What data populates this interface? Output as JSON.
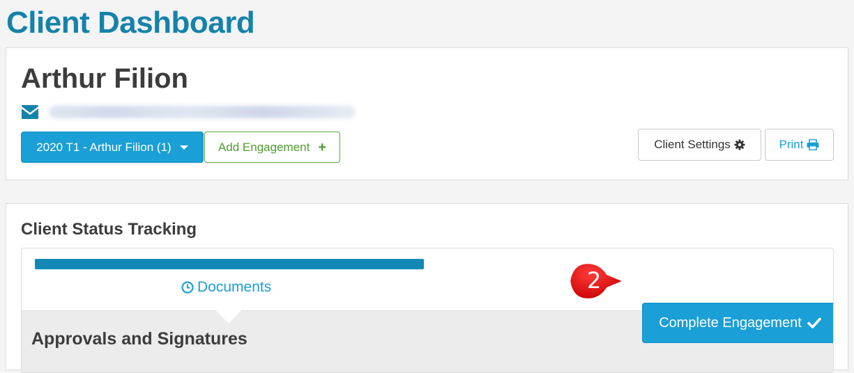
{
  "page": {
    "title": "Client Dashboard"
  },
  "client": {
    "name": "Arthur Filion",
    "email_icon": "envelope-icon"
  },
  "toolbar": {
    "engagement_select": "2020 T1 - Arthur Filion (1)",
    "add_engagement": "Add Engagement",
    "client_settings": "Client Settings",
    "print": "Print"
  },
  "status_tracking": {
    "title": "Client Status Tracking",
    "progress": 1.0,
    "current_step": "Documents",
    "next_section": "Approvals and Signatures",
    "complete_button": "Complete Engagement"
  },
  "annotation": {
    "step_number": "2"
  },
  "colors": {
    "title_blue": "#1582aa",
    "primary": "#1a9fd6",
    "progress_fill": "#1288b7",
    "success": "#4e9d2d",
    "callout_red": "#e60000"
  }
}
